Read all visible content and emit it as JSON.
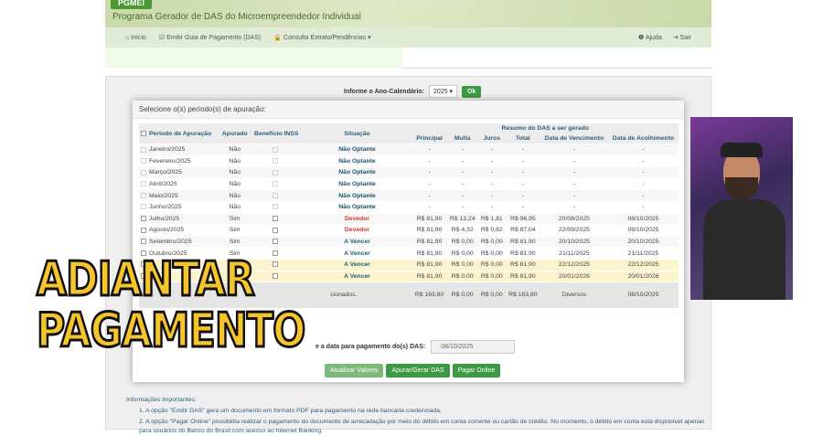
{
  "header": {
    "logo": "PGMEI",
    "title": "Programa Gerador de DAS do Microempreendedor Individual"
  },
  "nav": {
    "inicio": "⌂ Início",
    "emitir": "☑ Emitir Guia de Pagamento (DAS)",
    "consulta": "🔒 Consulta Extrato/Pendências ▾",
    "ajuda": "❶ Ajuda",
    "sair": "⇥ Sair"
  },
  "year": {
    "label": "Informe o Ano-Calendário:",
    "value": "2025 ▾",
    "ok": "Ok"
  },
  "modal": {
    "title": "Selecione o(s) período(s) de apuração:",
    "headers": {
      "periodo": "Período de Apuração",
      "apurado": "Apurado",
      "beneficio": "Benefício INSS",
      "situacao": "Situação",
      "resumo": "Resumo do DAS a ser gerado",
      "principal": "Principal",
      "multa": "Multa",
      "juros": "Juros",
      "total": "Total",
      "vencimento": "Data de Vencimento",
      "acolhimento": "Data de Acolhimento"
    },
    "rows": [
      {
        "periodo": "Janeiro/2025",
        "apurado": "Não",
        "situacao": "Não Optante",
        "principal": "-",
        "multa": "-",
        "juros": "-",
        "total": "-",
        "venc": "-",
        "acol": "-"
      },
      {
        "periodo": "Fevereiro/2025",
        "apurado": "Não",
        "situacao": "Não Optante",
        "principal": "-",
        "multa": "-",
        "juros": "-",
        "total": "-",
        "venc": "-",
        "acol": "-"
      },
      {
        "periodo": "Março/2025",
        "apurado": "Não",
        "situacao": "Não Optante",
        "principal": "-",
        "multa": "-",
        "juros": "-",
        "total": "-",
        "venc": "-",
        "acol": "-"
      },
      {
        "periodo": "Abril/2025",
        "apurado": "Não",
        "situacao": "Não Optante",
        "principal": "-",
        "multa": "-",
        "juros": "-",
        "total": "-",
        "venc": "-",
        "acol": "-"
      },
      {
        "periodo": "Maio/2025",
        "apurado": "Não",
        "situacao": "Não Optante",
        "principal": "-",
        "multa": "-",
        "juros": "-",
        "total": "-",
        "venc": "-",
        "acol": "-"
      },
      {
        "periodo": "Junho/2025",
        "apurado": "Não",
        "situacao": "Não Optante",
        "principal": "-",
        "multa": "-",
        "juros": "-",
        "total": "-",
        "venc": "-",
        "acol": "-"
      },
      {
        "periodo": "Julho/2025",
        "apurado": "Sim",
        "situacao": "Devedor",
        "principal": "R$ 81,90",
        "multa": "R$ 13,24",
        "juros": "R$ 1,81",
        "total": "R$ 96,95",
        "venc": "20/08/2025",
        "acol": "08/10/2025"
      },
      {
        "periodo": "Agosto/2025",
        "apurado": "Sim",
        "situacao": "Devedor",
        "principal": "R$ 81,90",
        "multa": "R$ 4,32",
        "juros": "R$ 0,82",
        "total": "R$ 87,04",
        "venc": "22/09/2025",
        "acol": "08/10/2025"
      },
      {
        "periodo": "Setembro/2025",
        "apurado": "Sim",
        "situacao": "A Vencer",
        "principal": "R$ 81,90",
        "multa": "R$ 0,00",
        "juros": "R$ 0,00",
        "total": "R$ 81,90",
        "venc": "20/10/2025",
        "acol": "20/10/2025"
      },
      {
        "periodo": "Outubro/2025",
        "apurado": "Sim",
        "situacao": "A Vencer",
        "principal": "R$ 81,90",
        "multa": "R$ 0,00",
        "juros": "R$ 0,00",
        "total": "R$ 81,90",
        "venc": "21/11/2025",
        "acol": "21/11/2025"
      },
      {
        "periodo": "",
        "apurado": "",
        "situacao": "A Vencer",
        "principal": "R$ 81,90",
        "multa": "R$ 0,00",
        "juros": "R$ 0,00",
        "total": "R$ 81,90",
        "venc": "22/12/2025",
        "acol": "22/12/2025"
      },
      {
        "periodo": "",
        "apurado": "",
        "situacao": "A Vencer",
        "principal": "R$ 81,90",
        "multa": "R$ 0,00",
        "juros": "R$ 0,00",
        "total": "R$ 81,90",
        "venc": "20/01/2026",
        "acol": "20/01/2026"
      }
    ],
    "totals": {
      "label": "cionados.",
      "principal": "R$ 163,80",
      "multa": "R$ 0,00",
      "juros": "R$ 0,00",
      "total": "R$ 163,80",
      "venc": "Diversos",
      "acol": "08/10/2025"
    },
    "date_label": "e a data para pagamento do(s) DAS:",
    "date_value": "08/10/2025",
    "buttons": {
      "atualizar": "Atualizar Valores",
      "apurar": "Apurar/Gerar DAS",
      "pagar": "Pagar Online"
    }
  },
  "info": {
    "title": "Informações importantes:",
    "items": [
      "1. A opção \"Emitir DAS\" gera um documento em formato PDF para pagamento na rede bancária credenciada.",
      "2. A opção \"Pagar Online\" possibilita realizar o pagamento do documento de arrecadação por meio do débito em conta corrente ou cartão de crédito. No momento, o débito em conta está disponível apenas para usuários do Banco do Brasil com acesso ao Internet Banking."
    ]
  },
  "overlay": {
    "line1": "ADIANTAR",
    "line2": "PAGAMENTO"
  }
}
